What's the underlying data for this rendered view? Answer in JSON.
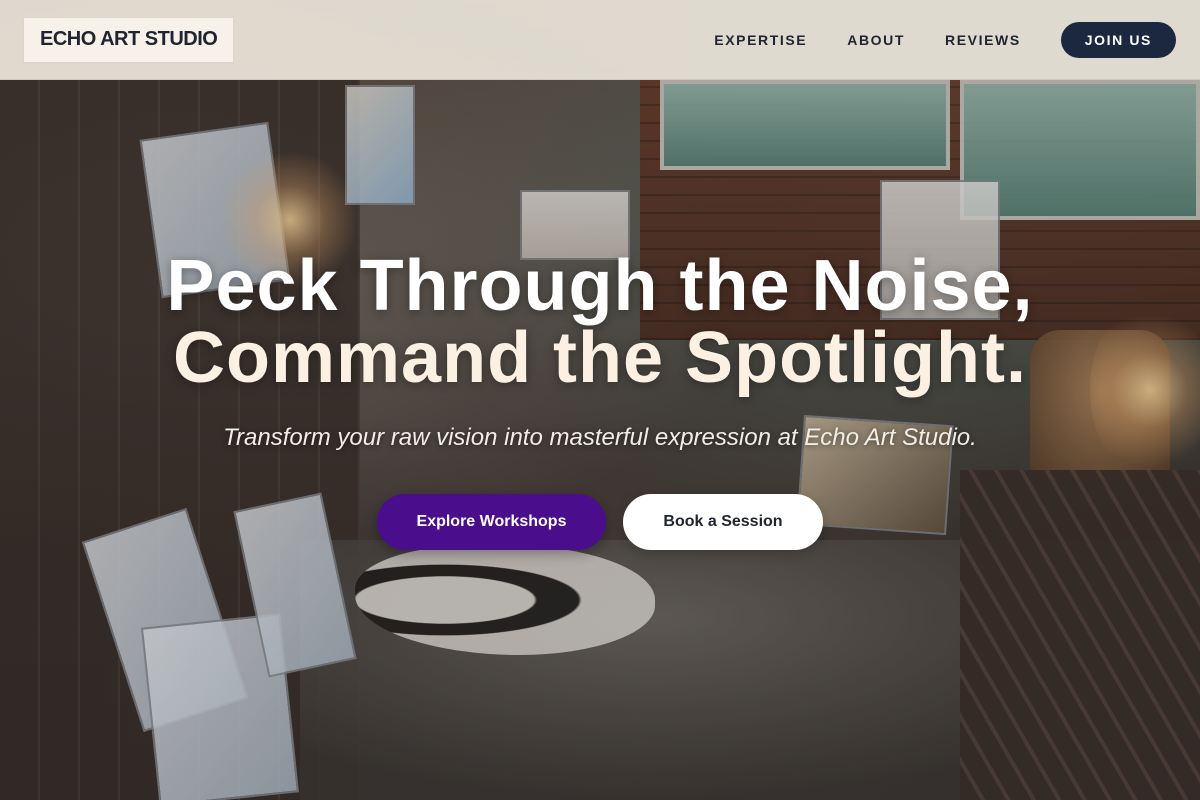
{
  "brand": {
    "name": "ECHO ART STUDIO"
  },
  "nav": {
    "links": [
      {
        "label": "EXPERTISE"
      },
      {
        "label": "ABOUT"
      },
      {
        "label": "REVIEWS"
      }
    ],
    "cta_label": "JOIN US"
  },
  "hero": {
    "headline_line1": "Peck Through the Noise,",
    "headline_line2": "Command the Spotlight.",
    "subtitle": "Transform your raw vision into masterful expression at Echo Art Studio.",
    "primary_button": "Explore Workshops",
    "secondary_button": "Book a Session"
  },
  "colors": {
    "header_bg": "#e8e2d8",
    "brand_text": "#1f2430",
    "join_button": "#1c2740",
    "primary_button": "#4a0e8c",
    "secondary_button": "#ffffff"
  }
}
